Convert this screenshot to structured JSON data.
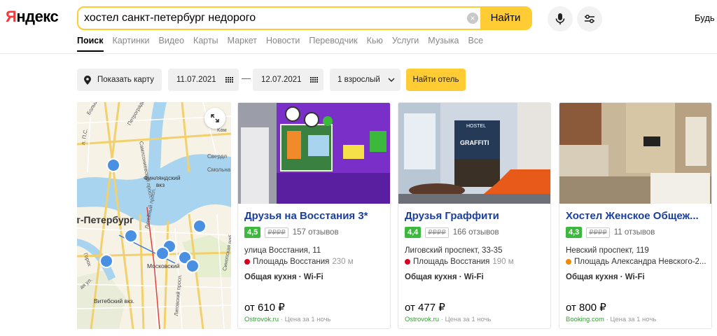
{
  "header": {
    "logo_first": "Я",
    "logo_rest": "ндекс",
    "search_value": "хостел санкт-петербург недорого",
    "find_button": "Найти",
    "cut_text": "Будь"
  },
  "tabs": [
    {
      "label": "Поиск",
      "active": true
    },
    {
      "label": "Картинки"
    },
    {
      "label": "Видео"
    },
    {
      "label": "Карты"
    },
    {
      "label": "Маркет"
    },
    {
      "label": "Новости"
    },
    {
      "label": "Переводчик"
    },
    {
      "label": "Кью"
    },
    {
      "label": "Услуги"
    },
    {
      "label": "Музыка"
    },
    {
      "label": "Все"
    }
  ],
  "filters": {
    "show_map": "Показать карту",
    "date_from": "11.07.2021",
    "date_to": "12.07.2021",
    "guests": "1 взрослый",
    "find_hotel": "Найти отель"
  },
  "map": {
    "labels": {
      "city": "т-Петербург",
      "finland_station": "Финляндский вкз",
      "moscow_station": "Московский",
      "vitebsk_station": "Витебский вкз.",
      "liteyny": "Литейный просп.",
      "sampsonievsky": "Сампсониевский просп.",
      "sverd": "Свердл",
      "smoln": "Смольна",
      "ligovsky": "Лиговский просп.",
      "sinopskaya": "Синопская наб.",
      "petrogr": "Петроградск",
      "gorokh": "Горох",
      "bolsh": "Большой просп.",
      "ps": "л. П.С.",
      "kam": "Кам",
      "yul": "ая ул."
    }
  },
  "hotels": [
    {
      "title": "Друзья на Восстания 3*",
      "rating": "4,5",
      "price_level": "₽₽₽₽",
      "reviews": "157 отзывов",
      "address": "улица Восстания, 11",
      "metro": "Площадь Восстания",
      "metro_distance": "230 м",
      "metro_color": "#d8001f",
      "features": "Общая кухня · Wi-Fi",
      "price": "от 610 ₽",
      "source": "Ostrovok.ru",
      "price_note": "Цена за 1 ночь"
    },
    {
      "title": "Друзья Граффити",
      "rating": "4,4",
      "price_level": "₽₽₽₽",
      "reviews": "166 отзывов",
      "address": "Лиговский проспект, 33-35",
      "metro": "Площадь Восстания",
      "metro_distance": "190 м",
      "metro_color": "#d8001f",
      "features": "Общая кухня · Wi-Fi",
      "price": "от 477 ₽",
      "source": "Ostrovok.ru",
      "price_note": "Цена за 1 ночь",
      "sign_top": "HOSTEL",
      "sign_main": "GRAFFITI"
    },
    {
      "title": "Хостел Женское Общеж...",
      "rating": "4,3",
      "price_level": "₽₽₽₽",
      "reviews": "11 отзывов",
      "address": "Невский проспект, 119",
      "metro": "Площадь Александра Невского-2...",
      "metro_distance": "",
      "metro_color": "#f08a00",
      "features": "Общая кухня · Wi-Fi",
      "price": "от 800 ₽",
      "source": "Booking.com",
      "price_note": "Цена за 1 ночь"
    }
  ],
  "colors": {
    "accent": "#ffcc33",
    "rating_green": "#3cb93c",
    "title_blue": "#1a3fa0",
    "hotel_pin": "#4a90e2"
  },
  "icons": [
    "pin-icon",
    "calendar-icon",
    "chevron-down-icon",
    "mic-icon",
    "settings-icon",
    "expand-icon",
    "clear-icon",
    "hotel-pin-icon"
  ]
}
